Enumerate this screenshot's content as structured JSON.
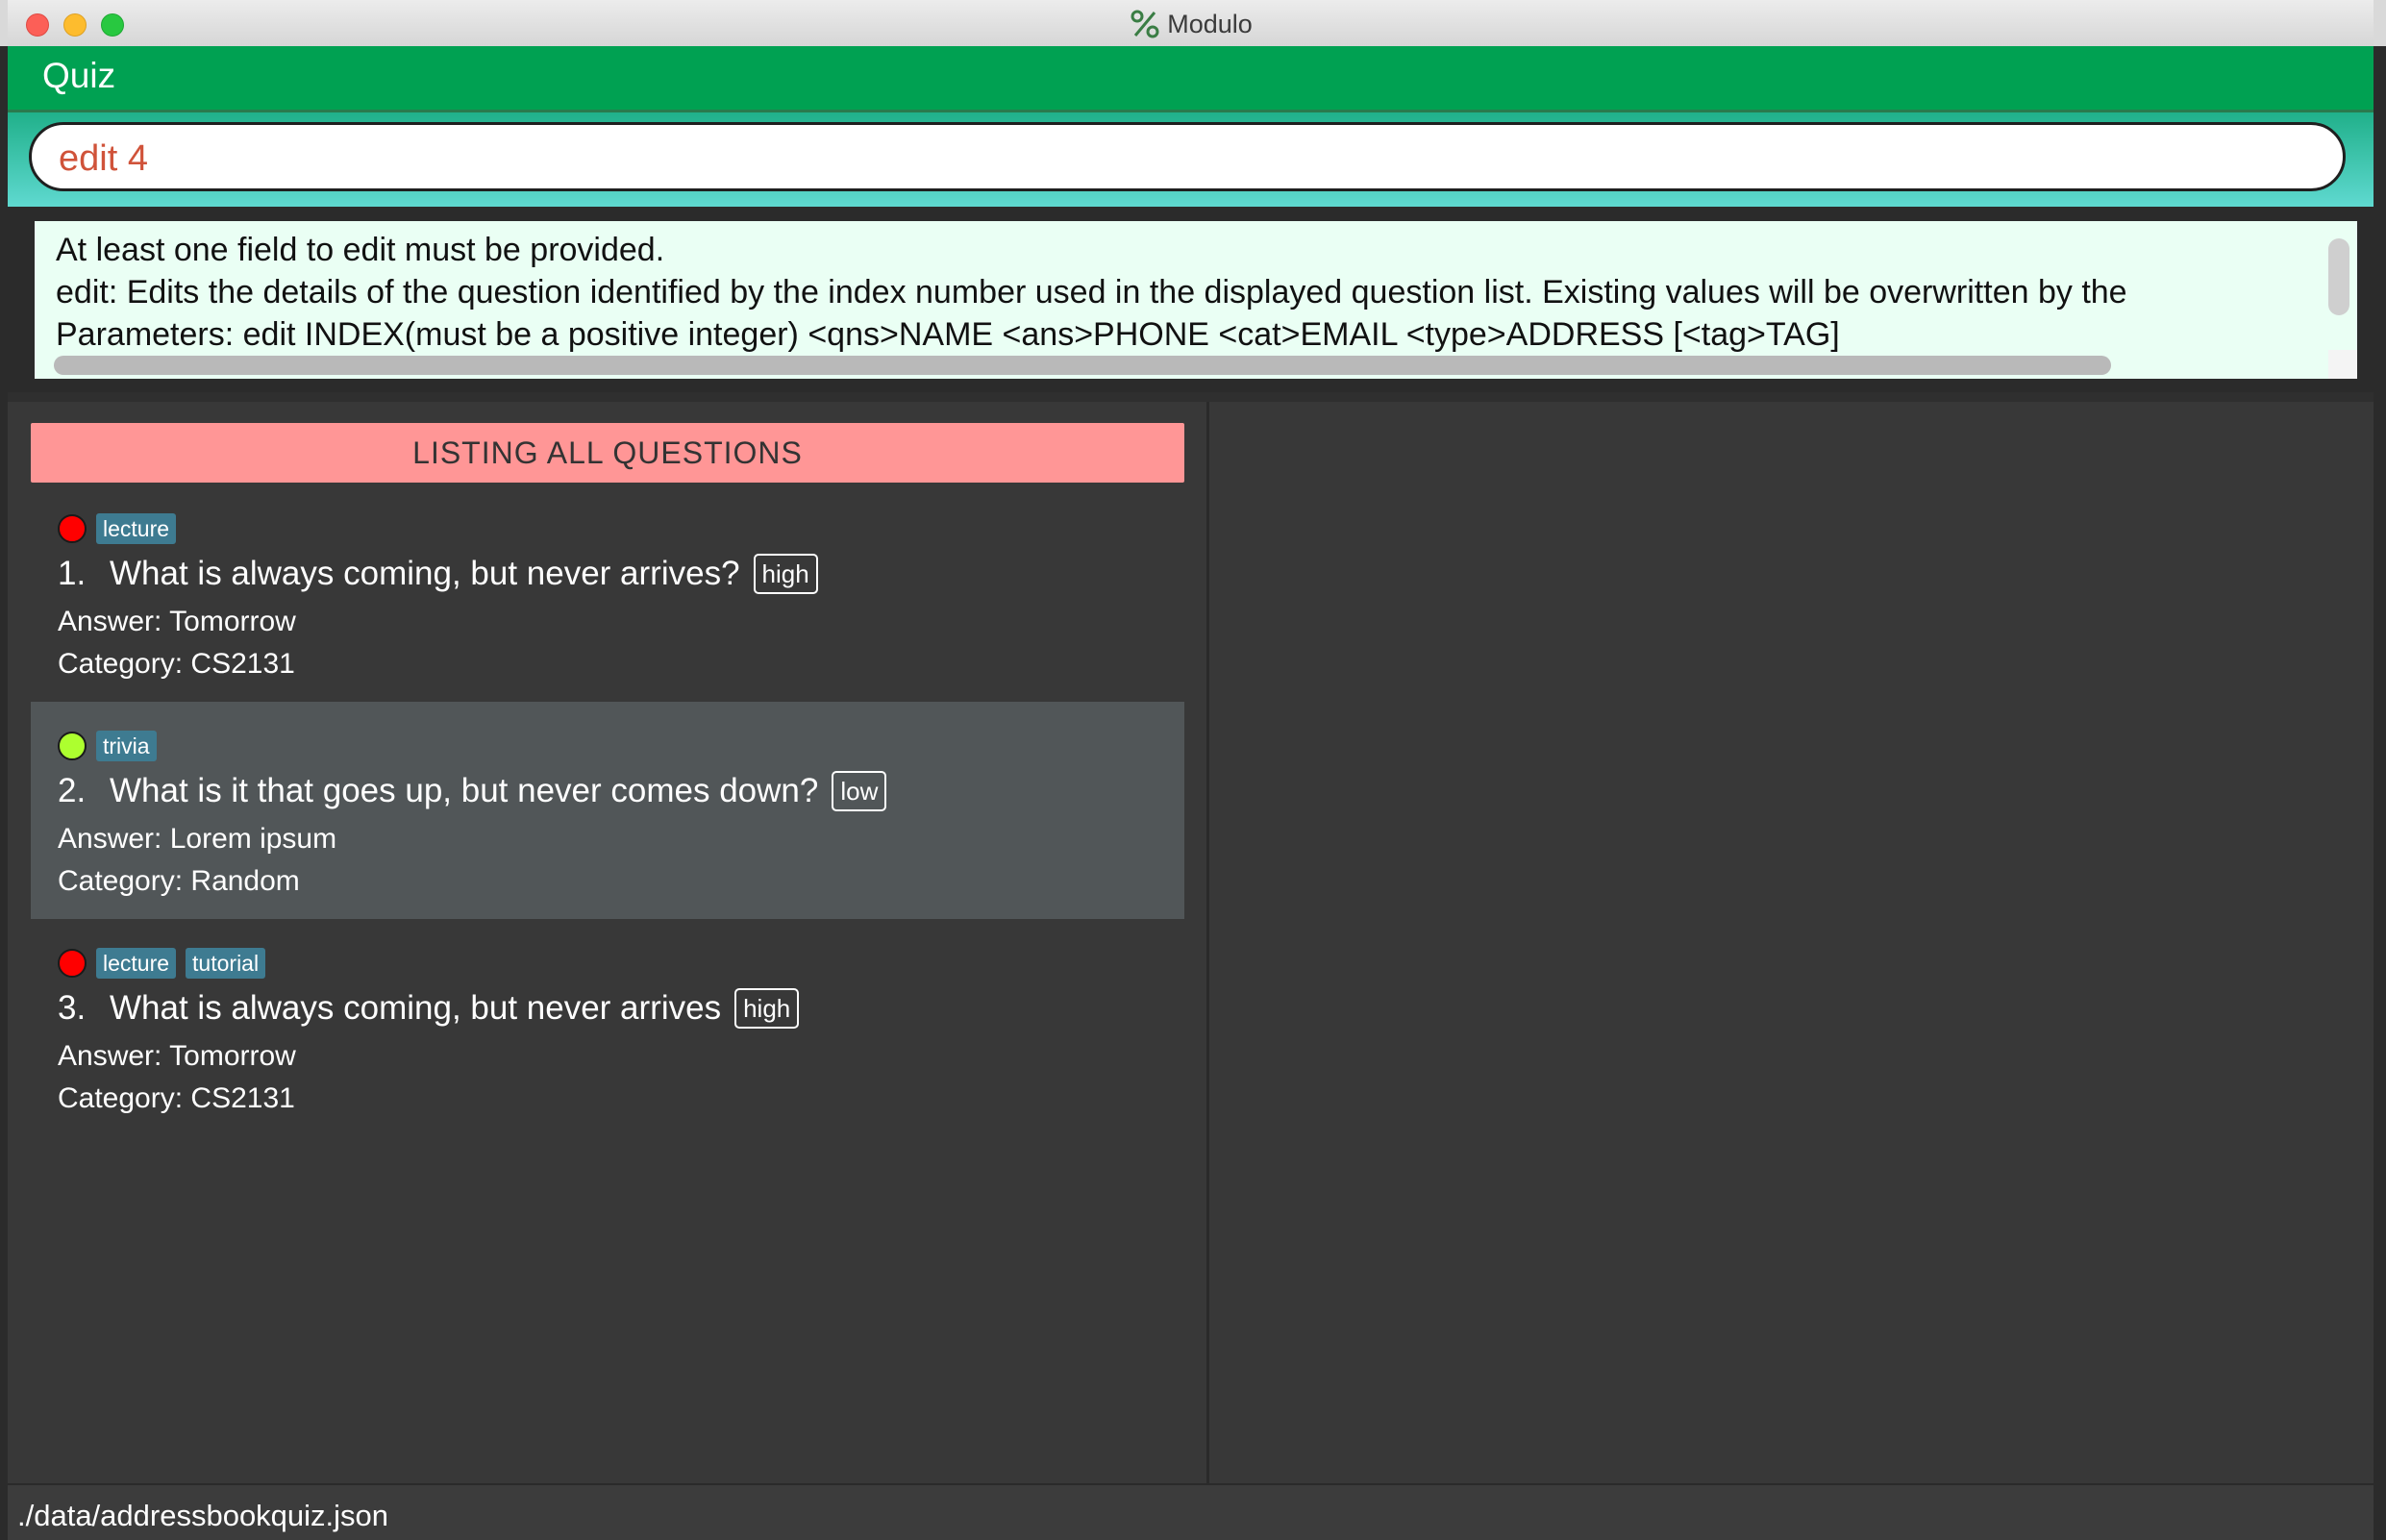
{
  "window": {
    "title": "Modulo",
    "logo_icon": "percent-icon"
  },
  "menu": {
    "title": "Quiz"
  },
  "command": {
    "value": "edit 4",
    "placeholder": ""
  },
  "result": {
    "lines": [
      "At least one field to edit must be provided.",
      "edit: Edits the details of the question identified by the index number used in the displayed question list. Existing values will be overwritten by the",
      "Parameters: edit INDEX(must be a positive integer) <qns>NAME <ans>PHONE <cat>EMAIL <type>ADDRESS [<tag>TAG]"
    ]
  },
  "list": {
    "header": "LISTING ALL QUESTIONS",
    "cards": [
      {
        "index": "1.",
        "question": "What is always coming, but never arrives?",
        "difficulty": "high",
        "status_color": "#ff0000",
        "tags": [
          "lecture"
        ],
        "answer": "Answer: Tomorrow",
        "category": "Category: CS2131"
      },
      {
        "index": "2.",
        "question": "What is it that goes up, but never comes down?",
        "difficulty": "low",
        "status_color": "#adff2f",
        "tags": [
          "trivia"
        ],
        "answer": "Answer: Lorem ipsum",
        "category": "Category: Random"
      },
      {
        "index": "3.",
        "question": "What is always coming, but never arrives",
        "difficulty": "high",
        "status_color": "#ff0000",
        "tags": [
          "lecture",
          "tutorial"
        ],
        "answer": "Answer: Tomorrow",
        "category": "Category: CS2131"
      }
    ]
  },
  "status": {
    "path": "./data/addressbookquiz.json"
  },
  "colors": {
    "menu_bar": "#00a152",
    "list_header": "#ff9696",
    "tag": "#3e7b91",
    "command_text": "#d0533a",
    "result_bg": "#eafff4"
  }
}
